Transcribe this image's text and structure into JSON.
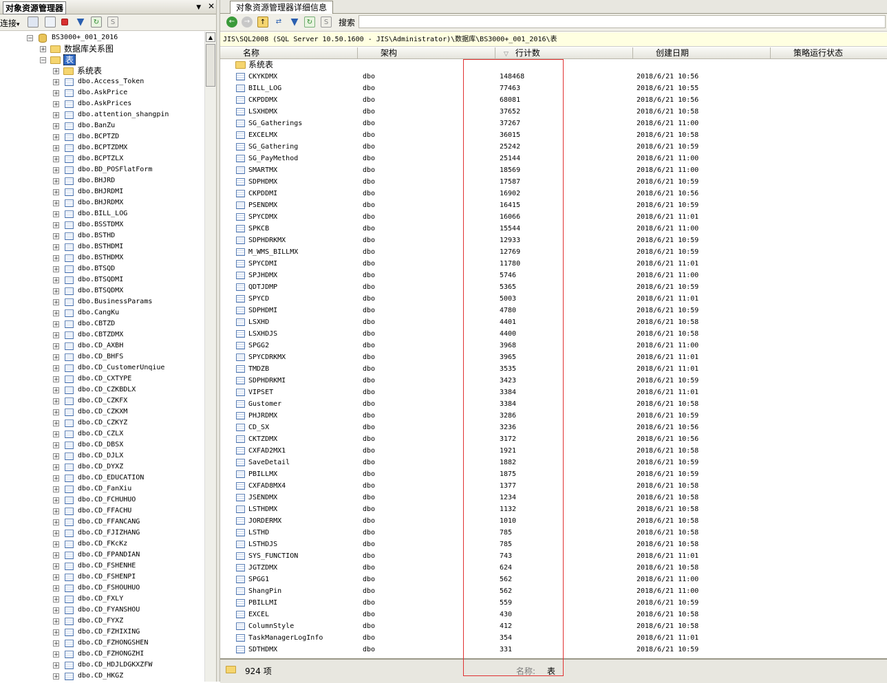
{
  "left_pane": {
    "title": "对象资源管理器",
    "connect_label": "连接",
    "connect_arrow": "▾",
    "pin_glyph": "▼",
    "close_glyph": "✕",
    "tree": {
      "database": "BS3000+_001_2016",
      "diagrams": "数据库关系图",
      "tables": "表",
      "system_tables": "系统表",
      "items": [
        "dbo.Access_Token",
        "dbo.AskPrice",
        "dbo.AskPrices",
        "dbo.attention_shangpin",
        "dbo.BanZu",
        "dbo.BCPTZD",
        "dbo.BCPTZDMX",
        "dbo.BCPTZLX",
        "dbo.BD_POSFlatForm",
        "dbo.BHJRD",
        "dbo.BHJRDMI",
        "dbo.BHJRDMX",
        "dbo.BILL_LOG",
        "dbo.BSSTDMX",
        "dbo.BSTHD",
        "dbo.BSTHDMI",
        "dbo.BSTHDMX",
        "dbo.BTSQD",
        "dbo.BTSQDMI",
        "dbo.BTSQDMX",
        "dbo.BusinessParams",
        "dbo.CangKu",
        "dbo.CBTZD",
        "dbo.CBTZDMX",
        "dbo.CD_AXBH",
        "dbo.CD_BHFS",
        "dbo.CD_CustomerUnqiue",
        "dbo.CD_CXTYPE",
        "dbo.CD_CZKBDLX",
        "dbo.CD_CZKFX",
        "dbo.CD_CZKXM",
        "dbo.CD_CZKYZ",
        "dbo.CD_CZLX",
        "dbo.CD_DBSX",
        "dbo.CD_DJLX",
        "dbo.CD_DYXZ",
        "dbo.CD_EDUCATION",
        "dbo.CD_FanXiu",
        "dbo.CD_FCHUHUO",
        "dbo.CD_FFACHU",
        "dbo.CD_FFANCANG",
        "dbo.CD_FJIZHANG",
        "dbo.CD_FKcKz",
        "dbo.CD_FPANDIAN",
        "dbo.CD_FSHENHE",
        "dbo.CD_FSHENPI",
        "dbo.CD_FSHOUHUO",
        "dbo.CD_FXLY",
        "dbo.CD_FYANSHOU",
        "dbo.CD_FYXZ",
        "dbo.CD_FZHIXING",
        "dbo.CD_FZHONGSHEN",
        "dbo.CD_FZHONGZHI",
        "dbo.CD_HDJLDGKXZFW",
        "dbo.CD_HKGZ"
      ]
    }
  },
  "right_pane": {
    "tab_label": "对象资源管理器详细信息",
    "search_label": "搜索",
    "path": "JIS\\SQL2008 (SQL Server 10.50.1600 - JIS\\Administrator)\\数据库\\BS3000+_001_2016\\表",
    "columns": [
      "名称",
      "架构",
      "行计数",
      "创建日期",
      "策略运行状态"
    ],
    "sort_glyph": "▽",
    "folder_row": "系统表",
    "rows": [
      [
        "CKYKDMX",
        "dbo",
        "148468",
        "2018/6/21 10:56"
      ],
      [
        "BILL_LOG",
        "dbo",
        "77463",
        "2018/6/21 10:55"
      ],
      [
        "CKPDDMX",
        "dbo",
        "68081",
        "2018/6/21 10:56"
      ],
      [
        "LSXHDMX",
        "dbo",
        "37652",
        "2018/6/21 10:58"
      ],
      [
        "SG_Gatherings",
        "dbo",
        "37267",
        "2018/6/21 11:00"
      ],
      [
        "EXCELMX",
        "dbo",
        "36015",
        "2018/6/21 10:58"
      ],
      [
        "SG_Gathering",
        "dbo",
        "25242",
        "2018/6/21 10:59"
      ],
      [
        "SG_PayMethod",
        "dbo",
        "25144",
        "2018/6/21 11:00"
      ],
      [
        "SMARTMX",
        "dbo",
        "18569",
        "2018/6/21 11:00"
      ],
      [
        "SDPHDMX",
        "dbo",
        "17587",
        "2018/6/21 10:59"
      ],
      [
        "CKPDDMI",
        "dbo",
        "16902",
        "2018/6/21 10:56"
      ],
      [
        "PSENDMX",
        "dbo",
        "16415",
        "2018/6/21 10:59"
      ],
      [
        "SPYCDMX",
        "dbo",
        "16066",
        "2018/6/21 11:01"
      ],
      [
        "SPKCB",
        "dbo",
        "15544",
        "2018/6/21 11:00"
      ],
      [
        "SDPHDRKMX",
        "dbo",
        "12933",
        "2018/6/21 10:59"
      ],
      [
        "M_WMS_BILLMX",
        "dbo",
        "12769",
        "2018/6/21 10:59"
      ],
      [
        "SPYCDMI",
        "dbo",
        "11780",
        "2018/6/21 11:01"
      ],
      [
        "SPJHDMX",
        "dbo",
        "5746",
        "2018/6/21 11:00"
      ],
      [
        "QDTJDMP",
        "dbo",
        "5365",
        "2018/6/21 10:59"
      ],
      [
        "SPYCD",
        "dbo",
        "5003",
        "2018/6/21 11:01"
      ],
      [
        "SDPHDMI",
        "dbo",
        "4780",
        "2018/6/21 10:59"
      ],
      [
        "LSXHD",
        "dbo",
        "4401",
        "2018/6/21 10:58"
      ],
      [
        "LSXHDJS",
        "dbo",
        "4400",
        "2018/6/21 10:58"
      ],
      [
        "SPGG2",
        "dbo",
        "3968",
        "2018/6/21 11:00"
      ],
      [
        "SPYCDRKMX",
        "dbo",
        "3965",
        "2018/6/21 11:01"
      ],
      [
        "TMDZB",
        "dbo",
        "3535",
        "2018/6/21 11:01"
      ],
      [
        "SDPHDRKMI",
        "dbo",
        "3423",
        "2018/6/21 10:59"
      ],
      [
        "VIPSET",
        "dbo",
        "3384",
        "2018/6/21 11:01"
      ],
      [
        "Gustomer",
        "dbo",
        "3384",
        "2018/6/21 10:58"
      ],
      [
        "PHJRDMX",
        "dbo",
        "3286",
        "2018/6/21 10:59"
      ],
      [
        "CD_SX",
        "dbo",
        "3236",
        "2018/6/21 10:56"
      ],
      [
        "CKTZDMX",
        "dbo",
        "3172",
        "2018/6/21 10:56"
      ],
      [
        "CXFAD2MX1",
        "dbo",
        "1921",
        "2018/6/21 10:58"
      ],
      [
        "SaveDetail",
        "dbo",
        "1882",
        "2018/6/21 10:59"
      ],
      [
        "PBILLMX",
        "dbo",
        "1875",
        "2018/6/21 10:59"
      ],
      [
        "CXFAD8MX4",
        "dbo",
        "1377",
        "2018/6/21 10:58"
      ],
      [
        "JSENDMX",
        "dbo",
        "1234",
        "2018/6/21 10:58"
      ],
      [
        "LSTHDMX",
        "dbo",
        "1132",
        "2018/6/21 10:58"
      ],
      [
        "JORDERMX",
        "dbo",
        "1010",
        "2018/6/21 10:58"
      ],
      [
        "LSTHD",
        "dbo",
        "785",
        "2018/6/21 10:58"
      ],
      [
        "LSTHDJS",
        "dbo",
        "785",
        "2018/6/21 10:58"
      ],
      [
        "SYS_FUNCTION",
        "dbo",
        "743",
        "2018/6/21 11:01"
      ],
      [
        "JGTZDMX",
        "dbo",
        "624",
        "2018/6/21 10:58"
      ],
      [
        "SPGG1",
        "dbo",
        "562",
        "2018/6/21 11:00"
      ],
      [
        "ShangPin",
        "dbo",
        "562",
        "2018/6/21 11:00"
      ],
      [
        "PBILLMI",
        "dbo",
        "559",
        "2018/6/21 10:59"
      ],
      [
        "EXCEL",
        "dbo",
        "430",
        "2018/6/21 10:58"
      ],
      [
        "ColumnStyle",
        "dbo",
        "412",
        "2018/6/21 10:58"
      ],
      [
        "TaskManagerLogInfo",
        "dbo",
        "354",
        "2018/6/21 11:01"
      ],
      [
        "SDTHDMX",
        "dbo",
        "331",
        "2018/6/21 10:59"
      ]
    ],
    "status": {
      "count_text": "924 项",
      "name_label": "名称:",
      "name_value": "表"
    }
  },
  "colors": {
    "highlight_box": "#e03131",
    "path_bar_bg": "#ffffe1"
  }
}
